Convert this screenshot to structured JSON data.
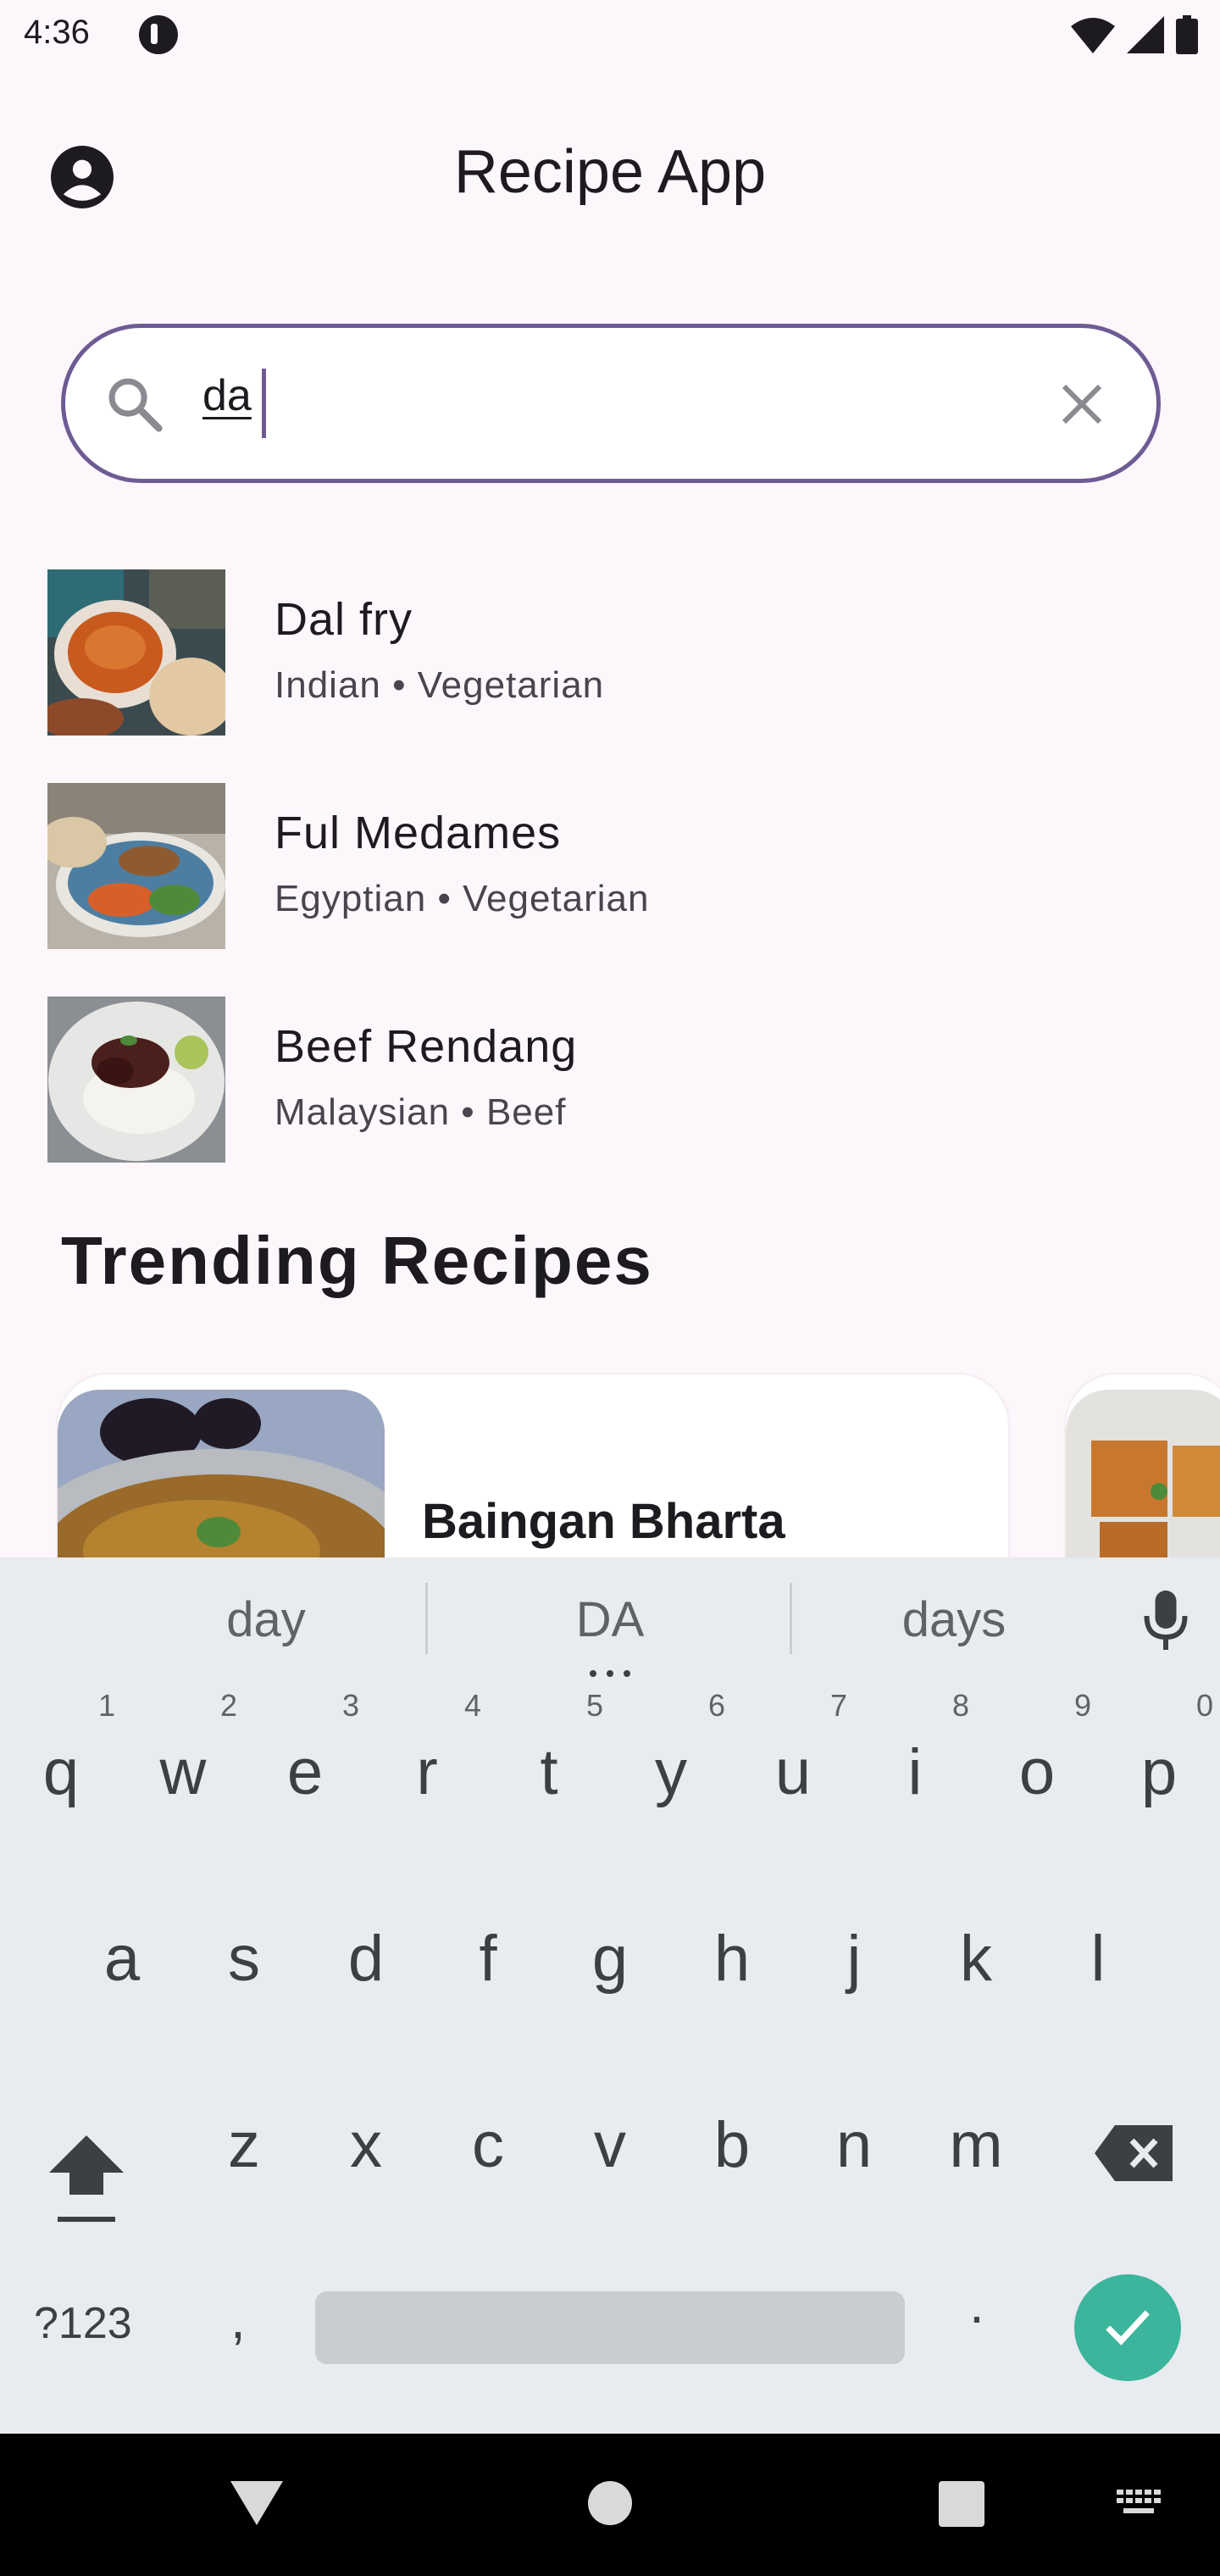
{
  "status_bar": {
    "time": "4:36"
  },
  "app_bar": {
    "title": "Recipe App"
  },
  "search": {
    "value": "da"
  },
  "results": [
    {
      "title": "Dal fry",
      "subtitle": "Indian • Vegetarian"
    },
    {
      "title": "Ful Medames",
      "subtitle": "Egyptian • Vegetarian"
    },
    {
      "title": "Beef Rendang",
      "subtitle": "Malaysian • Beef"
    }
  ],
  "trending": {
    "heading": "Trending Recipes",
    "cards": [
      {
        "title": "Baingan Bharta"
      }
    ]
  },
  "keyboard": {
    "suggestions": [
      "day",
      "DA",
      "days"
    ],
    "row1": [
      {
        "key": "q",
        "hint": "1"
      },
      {
        "key": "w",
        "hint": "2"
      },
      {
        "key": "e",
        "hint": "3"
      },
      {
        "key": "r",
        "hint": "4"
      },
      {
        "key": "t",
        "hint": "5"
      },
      {
        "key": "y",
        "hint": "6"
      },
      {
        "key": "u",
        "hint": "7"
      },
      {
        "key": "i",
        "hint": "8"
      },
      {
        "key": "o",
        "hint": "9"
      },
      {
        "key": "p",
        "hint": "0"
      }
    ],
    "row2": [
      "a",
      "s",
      "d",
      "f",
      "g",
      "h",
      "j",
      "k",
      "l"
    ],
    "row3": [
      "z",
      "x",
      "c",
      "v",
      "b",
      "n",
      "m"
    ],
    "symbols_label": "?123",
    "comma": ",",
    "period": ".",
    "colors": {
      "enter": "#3bb59b",
      "background": "#e8ebef"
    }
  },
  "colors": {
    "background": "#fdf7fc",
    "accent": "#6e5b94"
  }
}
